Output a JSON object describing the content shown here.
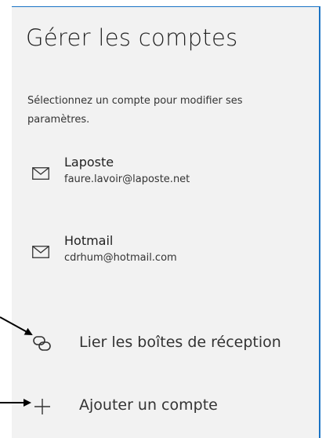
{
  "header": {
    "title": "Gérer les comptes",
    "subtitle": "Sélectionnez un compte pour modifier ses paramètres."
  },
  "accounts": [
    {
      "name": "Laposte",
      "email": "faure.lavoir@laposte.net",
      "icon": "mail-icon"
    },
    {
      "name": "Hotmail",
      "email": "cdrhum@hotmail.com",
      "icon": "mail-icon"
    }
  ],
  "actions": {
    "link_inboxes": {
      "label": "Lier les boîtes de réception",
      "icon": "link-icon"
    },
    "add_account": {
      "label": "Ajouter un compte",
      "icon": "plus-icon"
    }
  },
  "colors": {
    "panel_background": "#f2f2f2",
    "panel_border": "#1a73c4"
  }
}
